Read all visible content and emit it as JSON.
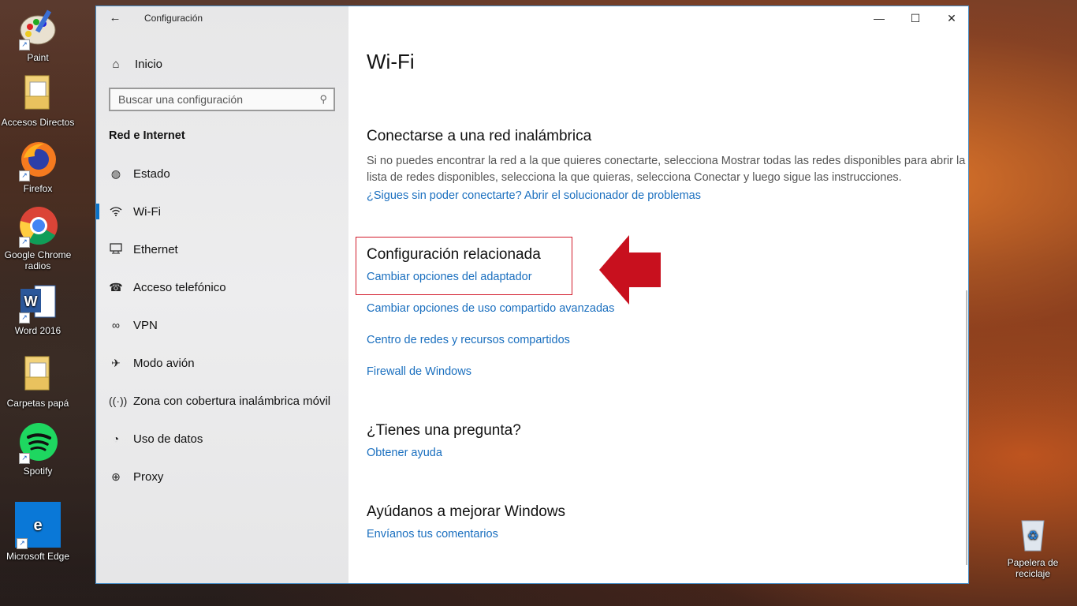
{
  "desktop": {
    "icons": [
      {
        "label": "Paint",
        "icon": "paint-palette-icon"
      },
      {
        "label": "Accesos Directos",
        "icon": "folder-icon"
      },
      {
        "label": "Firefox",
        "icon": "firefox-icon"
      },
      {
        "label": "Google Chrome radios",
        "icon": "chrome-icon"
      },
      {
        "label": "Word 2016",
        "icon": "word-icon"
      },
      {
        "label": "Carpetas papá",
        "icon": "folder-icon"
      },
      {
        "label": "Spotify",
        "icon": "spotify-icon"
      },
      {
        "label": "Microsoft Edge",
        "icon": "edge-icon"
      }
    ],
    "recycle_bin": {
      "label": "Papelera de reciclaje",
      "icon": "recycle-bin-icon"
    }
  },
  "window": {
    "title": "Configuración",
    "controls": {
      "minimize": "—",
      "maximize": "☐",
      "close": "✕"
    },
    "sidebar": {
      "home_label": "Inicio",
      "search_placeholder": "Buscar una configuración",
      "section_title": "Red e Internet",
      "items": [
        {
          "label": "Estado",
          "icon": "globe-icon"
        },
        {
          "label": "Wi-Fi",
          "icon": "wifi-icon",
          "active": true
        },
        {
          "label": "Ethernet",
          "icon": "ethernet-icon"
        },
        {
          "label": "Acceso telefónico",
          "icon": "dialup-icon"
        },
        {
          "label": "VPN",
          "icon": "vpn-icon"
        },
        {
          "label": "Modo avión",
          "icon": "airplane-icon"
        },
        {
          "label": "Zona con cobertura inalámbrica móvil",
          "icon": "hotspot-icon"
        },
        {
          "label": "Uso de datos",
          "icon": "data-usage-icon"
        },
        {
          "label": "Proxy",
          "icon": "proxy-globe-icon"
        }
      ]
    },
    "main": {
      "page_title": "Wi-Fi",
      "connect_section": {
        "heading": "Conectarse a una red inalámbrica",
        "body": "Si no puedes encontrar la red a la que quieres conectarte, selecciona Mostrar todas las redes disponibles para abrir la lista de redes disponibles, selecciona la que quieras, selecciona Conectar y luego sigue las instrucciones.",
        "link": "¿Sigues sin poder conectarte? Abrir el solucionador de problemas"
      },
      "related_section": {
        "heading": "Configuración relacionada",
        "links": [
          "Cambiar opciones del adaptador",
          "Cambiar opciones de uso compartido avanzadas",
          "Centro de redes y recursos compartidos",
          "Firewall de Windows"
        ]
      },
      "question_section": {
        "heading": "¿Tienes una pregunta?",
        "link": "Obtener ayuda"
      },
      "improve_section": {
        "heading": "Ayúdanos a mejorar Windows",
        "link": "Envíanos tus comentarios"
      }
    }
  },
  "colors": {
    "accent": "#0a72c8",
    "link": "#1a6fbf",
    "highlight_red": "#d11a2a"
  }
}
